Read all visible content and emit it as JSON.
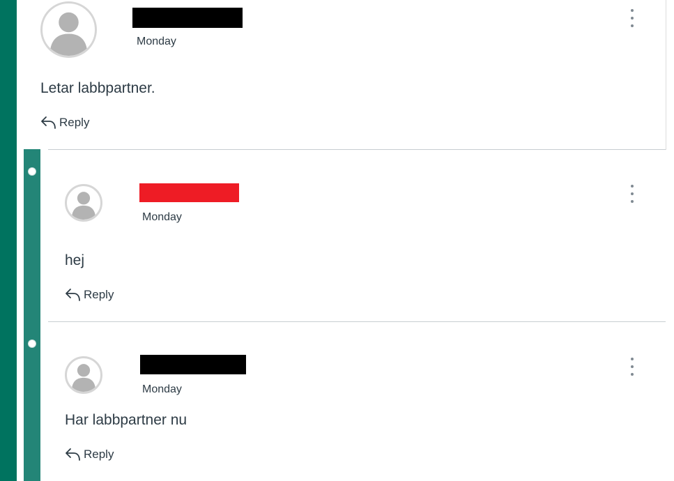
{
  "colors": {
    "outer_thread_bar": "#00735f",
    "reply_thread_bar": "#238577",
    "redaction_black": "#000000",
    "redaction_red": "#ee1c25",
    "text": "#2d3b45"
  },
  "posts": [
    {
      "author": "",
      "author_redaction": "black",
      "date": "Monday",
      "body": "Letar labbpartner.",
      "reply_label": "Reply",
      "avatar_icon": "default-user-avatar-icon",
      "menu_icon": "more-options-icon"
    },
    {
      "author": "",
      "author_redaction": "red",
      "date": "Monday",
      "body": "hej",
      "reply_label": "Reply",
      "avatar_icon": "default-user-avatar-icon",
      "menu_icon": "more-options-icon"
    },
    {
      "author": "",
      "author_redaction": "black",
      "date": "Monday",
      "body": "Har labbpartner nu",
      "reply_label": "Reply",
      "avatar_icon": "default-user-avatar-icon",
      "menu_icon": "more-options-icon"
    }
  ]
}
